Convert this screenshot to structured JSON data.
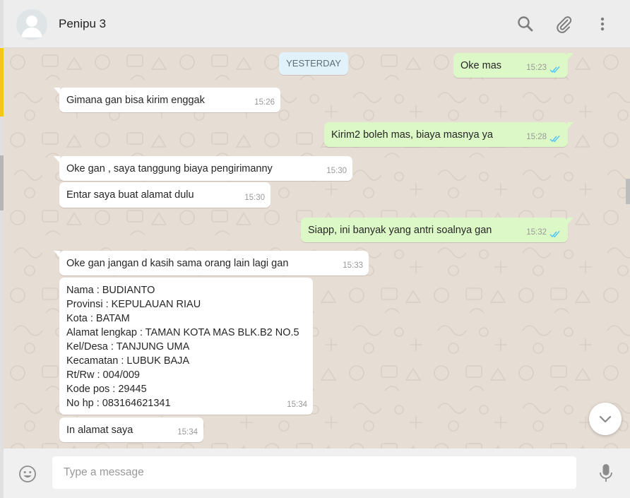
{
  "header": {
    "contact_name": "Penipu 3",
    "icons": [
      "search-icon",
      "attach-icon",
      "menu-icon"
    ]
  },
  "chat": {
    "date_badge": "YESTERDAY",
    "messages": [
      {
        "side": "out",
        "text": "Oke mas",
        "time": "15:23",
        "status": "read"
      },
      {
        "side": "in",
        "text": "Gimana gan bisa kirim enggak",
        "time": "15:26"
      },
      {
        "side": "out",
        "text": "Kirim2 boleh mas, biaya masnya ya",
        "time": "15:28",
        "status": "read"
      },
      {
        "side": "in",
        "text": "Oke gan , saya tanggung biaya pengirimanny",
        "time": "15:30"
      },
      {
        "side": "in",
        "text": "Entar saya buat alamat dulu",
        "time": "15:30"
      },
      {
        "side": "out",
        "text": "Siapp, ini banyak yang antri soalnya gan",
        "time": "15:32",
        "status": "read"
      },
      {
        "side": "in",
        "text": "Oke gan jangan d kasih sama orang lain lagi gan",
        "time": "15:33"
      },
      {
        "side": "in",
        "text": "Nama : BUDIANTO\nProvinsi : KEPULAUAN RIAU\nKota : BATAM\nAlamat lengkap : TAMAN KOTA MAS BLK.B2 NO.5\nKel/Desa : TANJUNG UMA\nKecamatan : LUBUK BAJA\nRt/Rw : 004/009\nKode pos : 29445\nNo hp : 083164621341",
        "time": "15:34"
      },
      {
        "side": "in",
        "text": "In alamat saya",
        "time": "15:34"
      }
    ]
  },
  "footer": {
    "placeholder": "Type a message"
  },
  "colors": {
    "chat_bg": "#e6ddd4",
    "incoming": "#ffffff",
    "outgoing": "#dcf8c6",
    "read_ticks": "#4fc3f7",
    "accent_bar": "#f5c518"
  }
}
